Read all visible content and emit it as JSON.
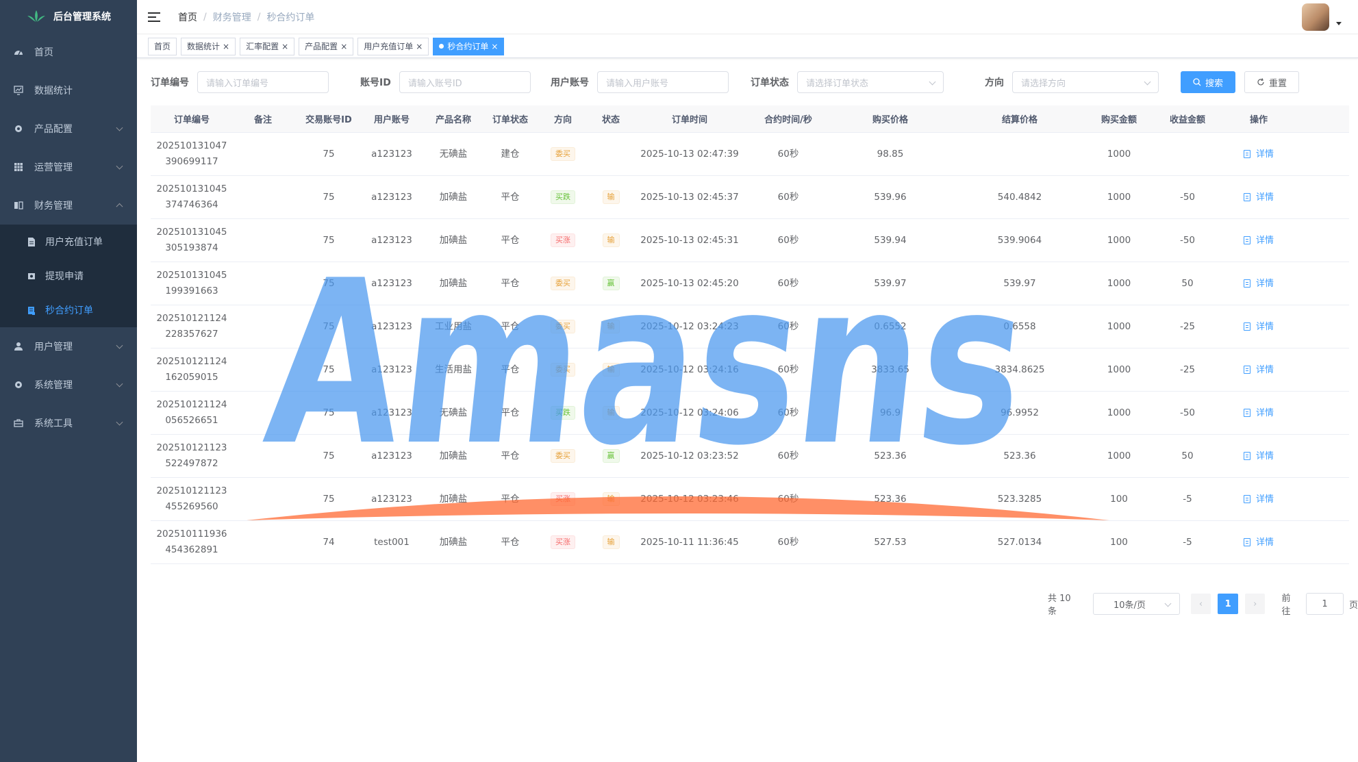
{
  "app": {
    "title": "后台管理系统"
  },
  "sidebar": {
    "items": [
      {
        "label": "首页",
        "icon": "dashboard-icon"
      },
      {
        "label": "数据统计",
        "icon": "chart-icon"
      },
      {
        "label": "产品配置",
        "icon": "gear-icon",
        "expandable": true
      },
      {
        "label": "运营管理",
        "icon": "grid-icon",
        "expandable": true
      },
      {
        "label": "财务管理",
        "icon": "book-icon",
        "expandable": true,
        "expanded": true
      },
      {
        "label": "用户管理",
        "icon": "user-icon",
        "expandable": true
      },
      {
        "label": "系统管理",
        "icon": "gear-icon",
        "expandable": true
      },
      {
        "label": "系统工具",
        "icon": "toolbox-icon",
        "expandable": true
      }
    ],
    "finance_sub": [
      {
        "label": "用户充值订单",
        "icon": "document-icon"
      },
      {
        "label": "提现申请",
        "icon": "money-icon"
      },
      {
        "label": "秒合约订单",
        "icon": "list-icon",
        "active": true
      }
    ]
  },
  "navbar": {
    "breadcrumb": [
      "首页",
      "财务管理",
      "秒合约订单"
    ]
  },
  "tags": [
    {
      "label": "首页",
      "closable": false
    },
    {
      "label": "数据统计",
      "closable": true
    },
    {
      "label": "汇率配置",
      "closable": true
    },
    {
      "label": "产品配置",
      "closable": true
    },
    {
      "label": "用户充值订单",
      "closable": true
    },
    {
      "label": "秒合约订单",
      "closable": true,
      "active": true
    }
  ],
  "search": {
    "order_no": {
      "label": "订单编号",
      "placeholder": "请输入订单编号"
    },
    "account_id": {
      "label": "账号ID",
      "placeholder": "请输入账号ID"
    },
    "user_account": {
      "label": "用户账号",
      "placeholder": "请输入用户账号"
    },
    "order_status": {
      "label": "订单状态",
      "placeholder": "请选择订单状态"
    },
    "direction": {
      "label": "方向",
      "placeholder": "请选择方向"
    },
    "search_label": "搜索",
    "reset_label": "重置"
  },
  "table": {
    "headers": [
      "订单编号",
      "备注",
      "交易账号ID",
      "用户账号",
      "产品名称",
      "订单状态",
      "方向",
      "状态",
      "订单时间",
      "合约时间/秒",
      "购买价格",
      "结算价格",
      "购买金额",
      "收益金额",
      "操作"
    ],
    "action_label": "详情",
    "rows": [
      {
        "order_no_1": "202510131047",
        "order_no_2": "390699117",
        "remark": "",
        "acct_id": "75",
        "user": "a123123",
        "product": "无碘盐",
        "order_status": "建仓",
        "direction": "委买",
        "direction_type": "warning",
        "status": "",
        "status_type": "",
        "time": "2025-10-13 02:47:39",
        "duration": "60秒",
        "buy_price": "98.85",
        "settle_price": "",
        "amount": "1000",
        "profit": ""
      },
      {
        "order_no_1": "202510131045",
        "order_no_2": "374746364",
        "remark": "",
        "acct_id": "75",
        "user": "a123123",
        "product": "加碘盐",
        "order_status": "平仓",
        "direction": "买跌",
        "direction_type": "success",
        "status": "输",
        "status_type": "warning",
        "time": "2025-10-13 02:45:37",
        "duration": "60秒",
        "buy_price": "539.96",
        "settle_price": "540.4842",
        "amount": "1000",
        "profit": "-50"
      },
      {
        "order_no_1": "202510131045",
        "order_no_2": "305193874",
        "remark": "",
        "acct_id": "75",
        "user": "a123123",
        "product": "加碘盐",
        "order_status": "平仓",
        "direction": "买涨",
        "direction_type": "danger",
        "status": "输",
        "status_type": "warning",
        "time": "2025-10-13 02:45:31",
        "duration": "60秒",
        "buy_price": "539.94",
        "settle_price": "539.9064",
        "amount": "1000",
        "profit": "-50"
      },
      {
        "order_no_1": "202510131045",
        "order_no_2": "199391663",
        "remark": "",
        "acct_id": "75",
        "user": "a123123",
        "product": "加碘盐",
        "order_status": "平仓",
        "direction": "委买",
        "direction_type": "warning",
        "status": "赢",
        "status_type": "success",
        "time": "2025-10-13 02:45:20",
        "duration": "60秒",
        "buy_price": "539.97",
        "settle_price": "539.97",
        "amount": "1000",
        "profit": "50"
      },
      {
        "order_no_1": "202510121124",
        "order_no_2": "228357627",
        "remark": "",
        "acct_id": "75",
        "user": "a123123",
        "product": "工业用盐",
        "order_status": "平仓",
        "direction": "委买",
        "direction_type": "warning",
        "status": "输",
        "status_type": "warning",
        "time": "2025-10-12 03:24:23",
        "duration": "60秒",
        "buy_price": "0.6552",
        "settle_price": "0.6558",
        "amount": "1000",
        "profit": "-25"
      },
      {
        "order_no_1": "202510121124",
        "order_no_2": "162059015",
        "remark": "",
        "acct_id": "75",
        "user": "a123123",
        "product": "生活用盐",
        "order_status": "平仓",
        "direction": "委买",
        "direction_type": "warning",
        "status": "输",
        "status_type": "warning",
        "time": "2025-10-12 03:24:16",
        "duration": "60秒",
        "buy_price": "3833.65",
        "settle_price": "3834.8625",
        "amount": "1000",
        "profit": "-25"
      },
      {
        "order_no_1": "202510121124",
        "order_no_2": "056526651",
        "remark": "",
        "acct_id": "75",
        "user": "a123123",
        "product": "无碘盐",
        "order_status": "平仓",
        "direction": "买跌",
        "direction_type": "success",
        "status": "输",
        "status_type": "warning",
        "time": "2025-10-12 03:24:06",
        "duration": "60秒",
        "buy_price": "96.9",
        "settle_price": "96.9952",
        "amount": "1000",
        "profit": "-50"
      },
      {
        "order_no_1": "202510121123",
        "order_no_2": "522497872",
        "remark": "",
        "acct_id": "75",
        "user": "a123123",
        "product": "加碘盐",
        "order_status": "平仓",
        "direction": "委买",
        "direction_type": "warning",
        "status": "赢",
        "status_type": "success",
        "time": "2025-10-12 03:23:52",
        "duration": "60秒",
        "buy_price": "523.36",
        "settle_price": "523.36",
        "amount": "1000",
        "profit": "50"
      },
      {
        "order_no_1": "202510121123",
        "order_no_2": "455269560",
        "remark": "",
        "acct_id": "75",
        "user": "a123123",
        "product": "加碘盐",
        "order_status": "平仓",
        "direction": "买涨",
        "direction_type": "danger",
        "status": "输",
        "status_type": "warning",
        "time": "2025-10-12 03:23:46",
        "duration": "60秒",
        "buy_price": "523.36",
        "settle_price": "523.3285",
        "amount": "100",
        "profit": "-5"
      },
      {
        "order_no_1": "202510111936",
        "order_no_2": "454362891",
        "remark": "",
        "acct_id": "74",
        "user": "test001",
        "product": "加碘盐",
        "order_status": "平仓",
        "direction": "买涨",
        "direction_type": "danger",
        "status": "输",
        "status_type": "warning",
        "time": "2025-10-11 11:36:45",
        "duration": "60秒",
        "buy_price": "527.53",
        "settle_price": "527.0134",
        "amount": "100",
        "profit": "-5"
      }
    ]
  },
  "pagination": {
    "total": "共 10 条",
    "page_size": "10条/页",
    "current": "1",
    "goto_label": "前往",
    "goto_value": "1",
    "page_suffix": "页"
  },
  "watermark": {
    "text": "Amasns",
    "color": "#4a98ef",
    "accent": "#ff6a33"
  },
  "colors": {
    "sidebar_bg": "#304156",
    "submenu_bg": "#1f2d3d",
    "primary": "#409eff"
  }
}
